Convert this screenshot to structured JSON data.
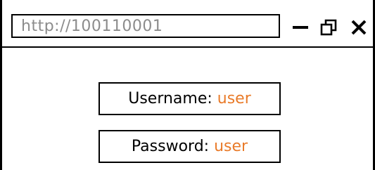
{
  "browser": {
    "url": "http://100110001",
    "controls": {
      "minimize_icon": "minimize-icon",
      "maximize_icon": "restore-window-icon",
      "close_icon": "close-icon"
    }
  },
  "login": {
    "username_label": "Username:",
    "username_value": "user",
    "password_label": "Password:",
    "password_value": "user"
  },
  "colors": {
    "value_accent": "#e97b2a",
    "url_text": "#8c8c8c",
    "border": "#000000"
  }
}
